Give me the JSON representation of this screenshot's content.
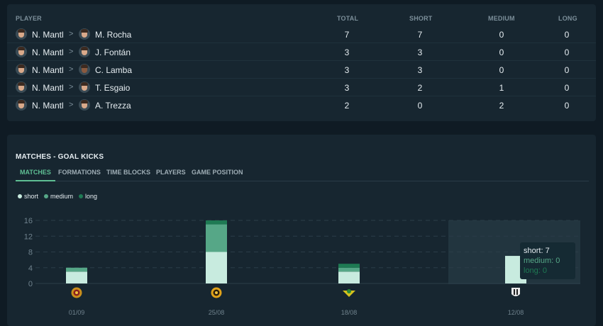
{
  "table": {
    "headers": {
      "player": "PLAYER",
      "total": "TOTAL",
      "short": "SHORT",
      "medium": "MEDIUM",
      "long": "LONG"
    },
    "rows": [
      {
        "from": "N. Mantl",
        "to": "M. Rocha",
        "total": "7",
        "short": "7",
        "medium": "0",
        "long": "0"
      },
      {
        "from": "N. Mantl",
        "to": "J. Fontán",
        "total": "3",
        "short": "3",
        "medium": "0",
        "long": "0"
      },
      {
        "from": "N. Mantl",
        "to": "C. Lamba",
        "total": "3",
        "short": "3",
        "medium": "0",
        "long": "0"
      },
      {
        "from": "N. Mantl",
        "to": "T. Esgaio",
        "total": "3",
        "short": "2",
        "medium": "1",
        "long": "0"
      },
      {
        "from": "N. Mantl",
        "to": "A. Trezza",
        "total": "2",
        "short": "0",
        "medium": "2",
        "long": "0"
      }
    ],
    "chevron": ">"
  },
  "matches_section": {
    "title": "MATCHES - GOAL KICKS",
    "tabs": [
      {
        "label": "MATCHES",
        "active": true
      },
      {
        "label": "FORMATIONS",
        "active": false
      },
      {
        "label": "TIME BLOCKS",
        "active": false
      },
      {
        "label": "PLAYERS",
        "active": false
      },
      {
        "label": "GAME POSITION",
        "active": false
      }
    ]
  },
  "colors": {
    "short": "#c8ebdf",
    "medium": "#56a787",
    "long": "#1e7a53",
    "accent": "#5fbf93"
  },
  "chart_data": {
    "type": "bar",
    "stacked": true,
    "categories": [
      "01/09",
      "25/08",
      "18/08",
      "12/08"
    ],
    "series": [
      {
        "name": "short",
        "values": [
          3,
          8,
          3,
          7
        ]
      },
      {
        "name": "medium",
        "values": [
          1,
          7,
          1,
          0
        ]
      },
      {
        "name": "long",
        "values": [
          0,
          1,
          1,
          0
        ]
      }
    ],
    "yticks": [
      0,
      4,
      8,
      12,
      16
    ],
    "ylim": [
      0,
      16
    ],
    "grid": true,
    "legend_position": "top-left",
    "highlighted_category": 3
  },
  "tooltip": {
    "short": "short: 7",
    "medium": "medium: 0",
    "long": "long: 0"
  }
}
